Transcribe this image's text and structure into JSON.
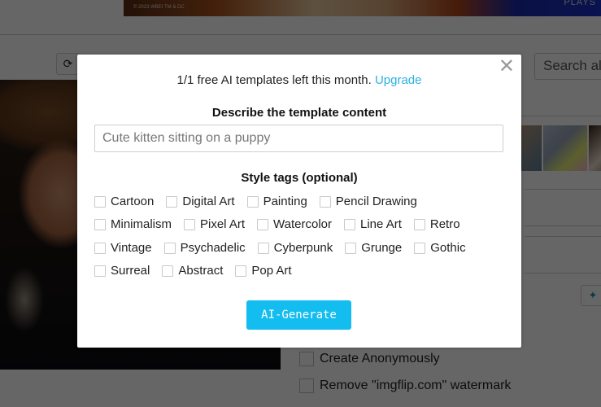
{
  "background": {
    "banner": {
      "credit": "© 2023 WBEI TM & DC",
      "tag": "PLAYS"
    },
    "toolbar": {
      "rotate_icon": "rotate-icon"
    },
    "search": {
      "placeholder": "Search all"
    },
    "watermark": "imgflip.com",
    "sparkle_icon": "sparkle-icon",
    "options": [
      {
        "label": "Create Anonymously",
        "checked": false
      },
      {
        "label": "Remove \"imgflip.com\" watermark",
        "checked": false
      }
    ]
  },
  "modal": {
    "close_icon": "close-icon",
    "close_glyph": "✕",
    "quota_text": "1/1 free AI templates left this month.",
    "upgrade_link": "Upgrade",
    "describe_title": "Describe the template content",
    "prompt": {
      "value": "",
      "placeholder": "Cute kitten sitting on a puppy"
    },
    "tags_title": "Style tags (optional)",
    "tag_rows": [
      [
        {
          "label": "Cartoon",
          "checked": false
        },
        {
          "label": "Digital Art",
          "checked": false
        },
        {
          "label": "Painting",
          "checked": false
        },
        {
          "label": "Pencil Drawing",
          "checked": false
        }
      ],
      [
        {
          "label": "Minimalism",
          "checked": false
        },
        {
          "label": "Pixel Art",
          "checked": false
        },
        {
          "label": "Watercolor",
          "checked": false
        },
        {
          "label": "Line Art",
          "checked": false
        },
        {
          "label": "Retro",
          "checked": false
        }
      ],
      [
        {
          "label": "Vintage",
          "checked": false
        },
        {
          "label": "Psychadelic",
          "checked": false
        },
        {
          "label": "Cyberpunk",
          "checked": false
        },
        {
          "label": "Grunge",
          "checked": false
        },
        {
          "label": "Gothic",
          "checked": false
        }
      ],
      [
        {
          "label": "Surreal",
          "checked": false
        },
        {
          "label": "Abstract",
          "checked": false
        },
        {
          "label": "Pop Art",
          "checked": false
        }
      ]
    ],
    "generate_label": "AI-Generate"
  },
  "colors": {
    "accent": "#13bdf0",
    "link": "#2cb0e2",
    "overlay": "rgba(0,0,0,0.6)"
  }
}
